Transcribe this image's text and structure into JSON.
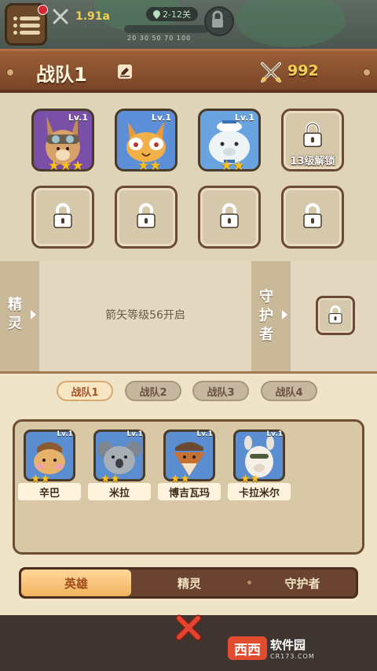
{
  "hud": {
    "power": "1.91a",
    "stage": "2-12关",
    "stage_steps": "20  30  50  70  100"
  },
  "header": {
    "title": "战队1",
    "power_total": "992"
  },
  "team_slots": [
    {
      "level": "Lv.1",
      "stars": "★★★",
      "color": "#7a4fa8"
    },
    {
      "level": "Lv.1",
      "stars": "★★",
      "color": "#5c8fd8"
    },
    {
      "level": "Lv.1",
      "stars": "★★",
      "color": "#6aa4e0"
    }
  ],
  "locked_slot_text": "13级解锁",
  "spirit": {
    "label": "精灵",
    "message": "箭矢等级56开启"
  },
  "guardian": {
    "label": "守护者"
  },
  "team_tabs": [
    "战队1",
    "战队2",
    "战队3",
    "战队4"
  ],
  "roster": [
    {
      "name": "辛巴",
      "level": "Lv.1",
      "stars": "★★"
    },
    {
      "name": "米拉",
      "level": "Lv.1",
      "stars": "★★"
    },
    {
      "name": "博吉瓦玛",
      "level": "Lv.1",
      "stars": "★★"
    },
    {
      "name": "卡拉米尔",
      "level": "Lv.1",
      "stars": "★★"
    }
  ],
  "type_tabs": [
    "英雄",
    "精灵",
    "守护者"
  ],
  "watermark": {
    "badge": "西西",
    "title": "软件园",
    "sub": "CR173.COM"
  }
}
